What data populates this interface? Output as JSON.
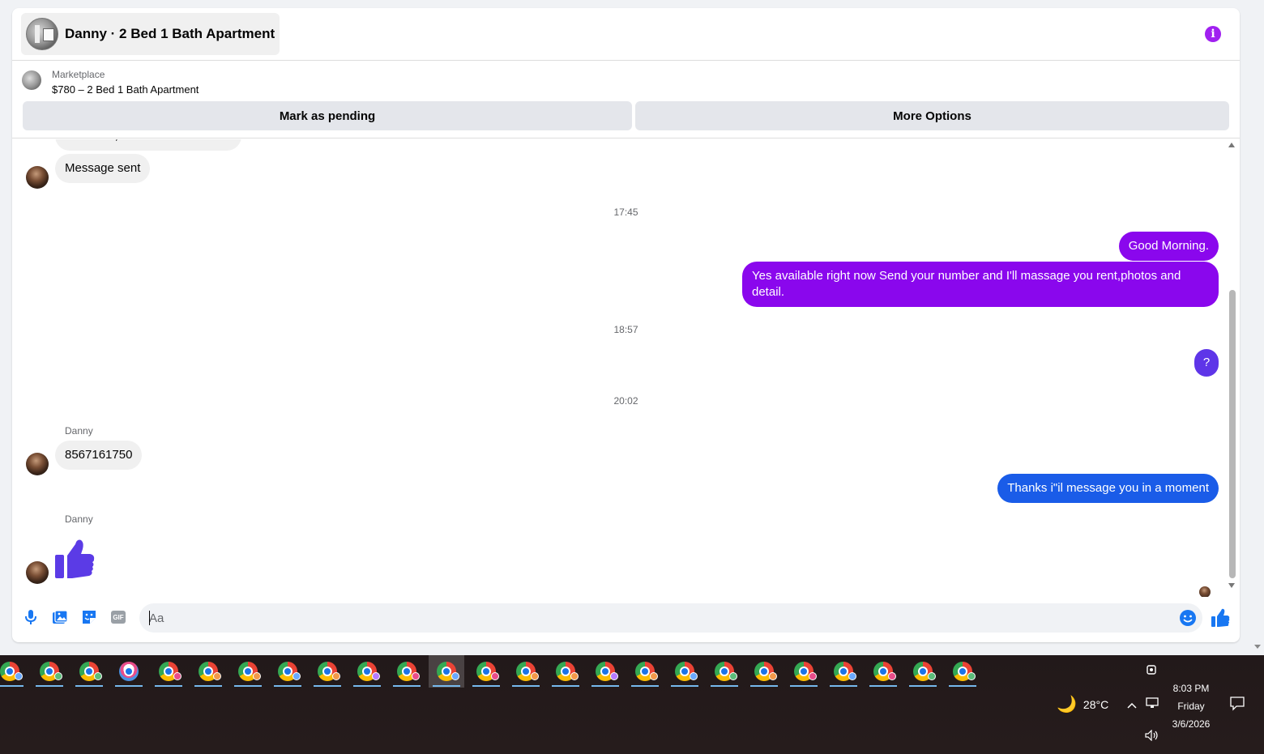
{
  "header": {
    "title": "Danny · 2 Bed 1 Bath Apartment",
    "info_icon": "info-icon"
  },
  "listing": {
    "label": "Marketplace",
    "price_title": "$780 – 2 Bed 1 Bath Apartment",
    "mark_pending_label": "Mark as pending",
    "more_options_label": "More Options"
  },
  "messages": {
    "cut_off_text": "Hi Niamh, is this still available?",
    "message_sent": "Message sent",
    "time_1": "17:45",
    "good_morning": "Good Morning.",
    "available_msg": "Yes available right now Send your number and I'll massage you rent,photos and detail.",
    "time_2": "18:57",
    "question": "?",
    "time_3": "20:02",
    "sender_1": "Danny",
    "phone": "8567161750",
    "thanks_msg": "Thanks i\"il message you in a moment",
    "sender_2": "Danny"
  },
  "composer": {
    "placeholder": "Aa"
  },
  "colors": {
    "purple": "#8a07ed",
    "indigo": "#5e35e8",
    "blue": "#1a5ce8",
    "thumb": "#5b3be6"
  },
  "taskbar": {
    "profile_colors": [
      "#6aa9ff",
      "#5bbd7a",
      "#5bbd7a",
      "#e94d8a",
      "#e94d8a",
      "#f2994a",
      "#f2994a",
      "#6aa9ff",
      "#f2994a",
      "#b57bff",
      "#e94d8a",
      "#6aa9ff",
      "#e94d8a",
      "#f2994a",
      "#f2994a",
      "#b57bff",
      "#f2994a",
      "#6aa9ff",
      "#5bbd7a",
      "#f2994a",
      "#e94d8a",
      "#6aa9ff",
      "#e94d8a",
      "#5bbd7a",
      "#5bbd7a"
    ],
    "temperature": "28°C",
    "time": "8:03 PM",
    "day": "Friday",
    "date": "3/6/2026"
  }
}
